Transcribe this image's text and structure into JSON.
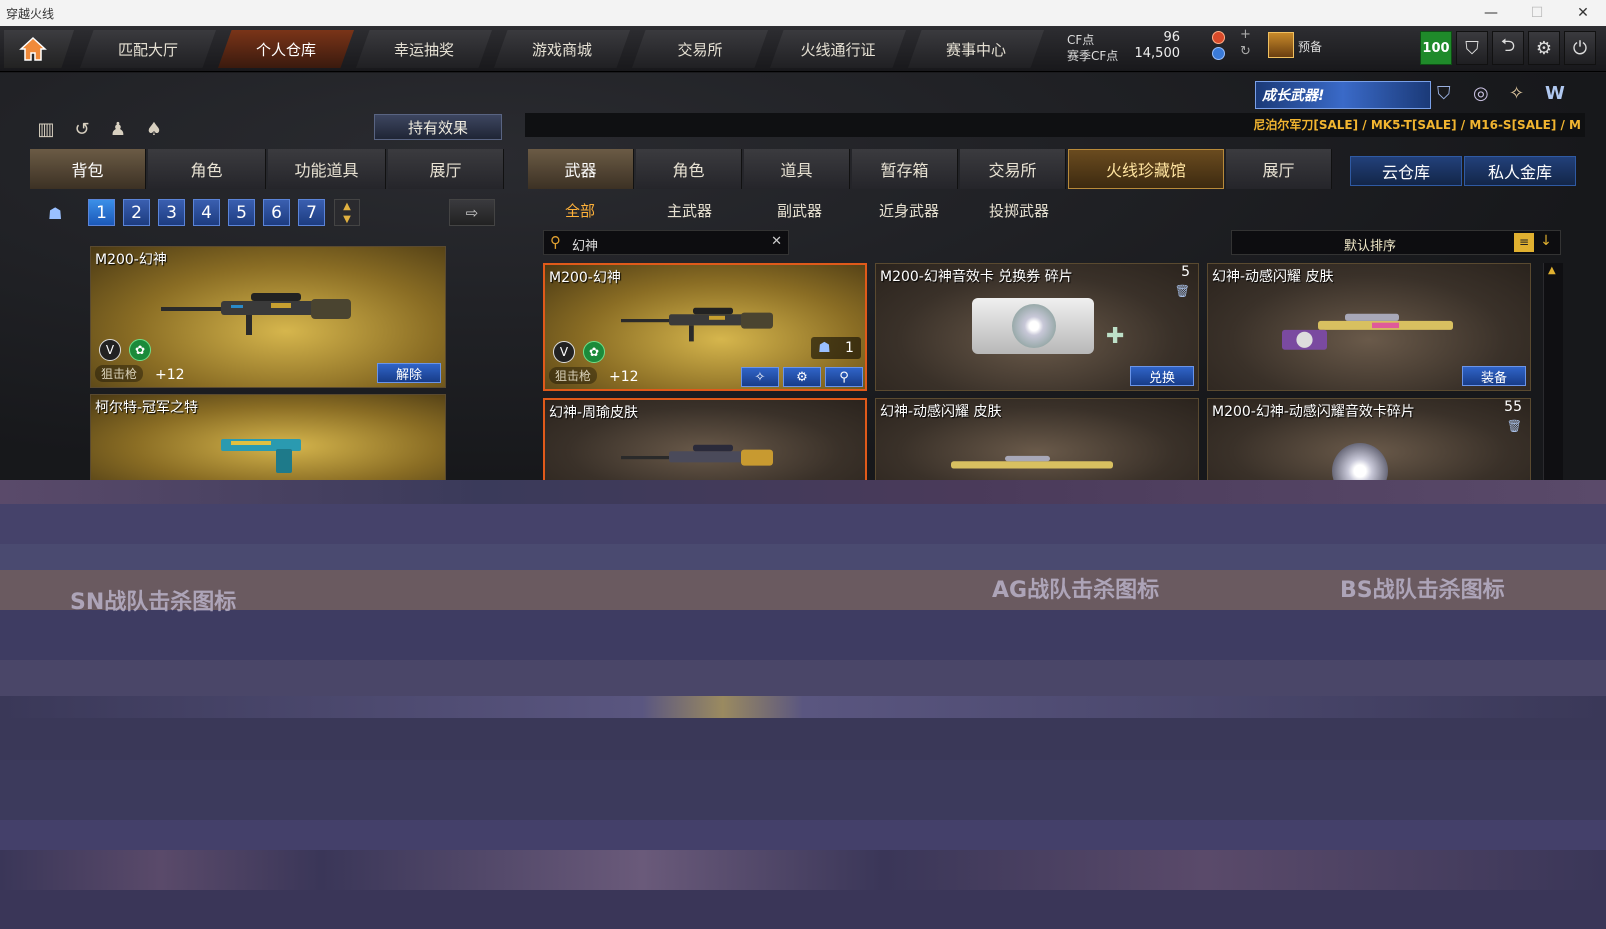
{
  "window": {
    "title": "穿越火线",
    "controls": [
      "—",
      "☐",
      "✕"
    ]
  },
  "topnav": {
    "tabs": [
      {
        "label": "匹配大厅"
      },
      {
        "label": "个人仓库"
      },
      {
        "label": "幸运抽奖"
      },
      {
        "label": "游戏商城"
      },
      {
        "label": "交易所"
      },
      {
        "label": "火线通行证"
      },
      {
        "label": "赛事中心"
      }
    ],
    "active_tab": "个人仓库",
    "currency": {
      "cf_label": "CF点",
      "cf_value": "96",
      "season_label": "赛季CF点",
      "season_value": "14,500"
    },
    "rank_label": "预备",
    "badge_value": "100",
    "icons": [
      "shield-icon",
      "exit-icon",
      "gear-icon",
      "power-icon"
    ]
  },
  "left_panel": {
    "effect_button": "持有效果",
    "tabs": [
      {
        "label": "背包"
      },
      {
        "label": "角色"
      },
      {
        "label": "功能道具"
      },
      {
        "label": "展厅"
      }
    ],
    "pages": [
      "1",
      "2",
      "3",
      "4",
      "5",
      "6",
      "7"
    ],
    "items": [
      {
        "title": "M200-幻神",
        "tag": "狙击枪",
        "plus": "+12",
        "button": "解除"
      },
      {
        "title": "柯尔特-冠军之特"
      }
    ]
  },
  "right_panel": {
    "promo": "成长武器!",
    "ticker": "尼泊尔军刀[SALE] / MK5-T[SALE] / M16-S[SALE] / M",
    "tabs": [
      {
        "label": "武器"
      },
      {
        "label": "角色"
      },
      {
        "label": "道具"
      },
      {
        "label": "暂存箱"
      },
      {
        "label": "交易所"
      },
      {
        "label": "火线珍藏馆"
      },
      {
        "label": "展厅"
      }
    ],
    "storage_tabs": [
      {
        "label": "云仓库"
      },
      {
        "label": "私人金库"
      }
    ],
    "subtabs": [
      {
        "label": "全部"
      },
      {
        "label": "主武器"
      },
      {
        "label": "副武器"
      },
      {
        "label": "近身武器"
      },
      {
        "label": "投掷武器"
      }
    ],
    "search": {
      "value": "幻神"
    },
    "sort_label": "默认排序",
    "items": [
      {
        "title": "M200-幻神",
        "tag": "狙击枪",
        "plus": "+12",
        "count": "1"
      },
      {
        "title": "M200-幻神音效卡 兑换券 碎片",
        "count": "5",
        "button": "兑换"
      },
      {
        "title": "幻神-动感闪耀 皮肤",
        "button": "装备"
      },
      {
        "title": "幻神-周瑜皮肤"
      },
      {
        "title": "幻神-动感闪耀 皮肤"
      },
      {
        "title": "M200-幻神-动感闪耀音效卡碎片",
        "count": "55"
      }
    ]
  },
  "glitch_area": {
    "texts": [
      "SN战队击杀图标",
      "AG战队击杀图标",
      "BS战队击杀图标"
    ]
  },
  "colors": {
    "accent_orange": "#e05a1a",
    "accent_gold": "#f2b530",
    "button_blue": "#3064c8",
    "badge_green": "#1f8a2a"
  }
}
